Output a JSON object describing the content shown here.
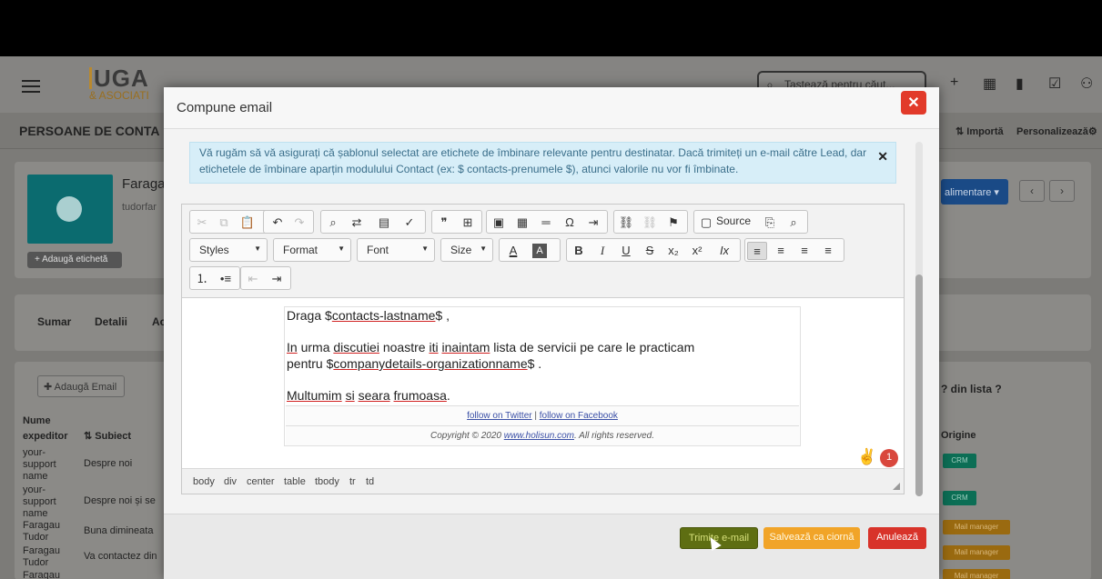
{
  "app": {
    "logo_top": "UGA",
    "logo_bottom": "& ASOCIATI",
    "search_placeholder": "Tastează pentru căut...",
    "page_title": "PERSOANE DE CONTA",
    "importa": "⇅ Importă",
    "personalizeaza": "Personalizează⚙",
    "contact_name": "Faraga",
    "contact_sub": "tudorfar",
    "add_tag": "+ Adaugă etichetă",
    "blue_button": "alimentare ▾",
    "tabs": [
      "Sumar",
      "Detalii",
      "Ac"
    ],
    "add_email": "✚ Adaugă Email",
    "pager": "? din lista ?",
    "columns": {
      "sender": "Nume expeditor",
      "subject": "Subiect",
      "origin": "Origine"
    },
    "rows": [
      {
        "sender": "your-support name",
        "subject": "Despre noi",
        "origin": "CRM"
      },
      {
        "sender": "your-support name",
        "subject": "Despre noi și se",
        "origin": "CRM"
      },
      {
        "sender": "Faragau Tudor",
        "subject": "Buna dimineata",
        "origin": "Mail manager"
      },
      {
        "sender": "Faragau Tudor",
        "subject": "Va contactez din",
        "origin": "Mail manager"
      },
      {
        "sender": "Faragau",
        "subject": "",
        "origin": "Mail manager"
      }
    ]
  },
  "modal": {
    "title": "Compune email",
    "alert": "Vă rugăm să vă asigurați că șablonul selectat are etichete de îmbinare relevante pentru destinatar. Dacă trimiteți un e-mail către Lead, dar etichetele de îmbinare aparțin modulului Contact (ex: $ contacts-prenumele $), atunci valorile nu vor fi îmbinate.",
    "toolbar": {
      "styles": "Styles",
      "format": "Format",
      "font": "Font",
      "size": "Size",
      "source": "Source"
    },
    "body": {
      "line1_a": "Draga $",
      "line1_b": "contacts-lastname",
      "line1_c": "$ ,",
      "line2_a": "In",
      "line2_b": " urma ",
      "line2_c": "discutiei",
      "line2_d": " noastre ",
      "line2_e": "iti",
      "line2_f": " ",
      "line2_g": "inaintam",
      "line2_h": " lista de servicii pe care le practicam",
      "line3_a": "pentru $",
      "line3_b": "companydetails-organizationname",
      "line3_c": "$ .",
      "line4_a": "Multumim",
      "line4_b": " ",
      "line4_c": "si",
      "line4_d": " ",
      "line4_e": "seara",
      "line4_f": " ",
      "line4_g": "frumoasa",
      "line4_h": ".",
      "follow_twitter": "follow on Twitter",
      "separator": " | ",
      "follow_facebook": "follow on Facebook",
      "copyright_a": "Copyright © 2020 ",
      "copyright_link": "www.holisun.com",
      "copyright_b": ". All rights reserved."
    },
    "badge_count": "1",
    "path": [
      "body",
      "div",
      "center",
      "table",
      "tbody",
      "tr",
      "td"
    ],
    "buttons": {
      "send": "Trimite e-mail",
      "draft": "Salvează ca ciornă",
      "cancel": "Anulează"
    }
  }
}
